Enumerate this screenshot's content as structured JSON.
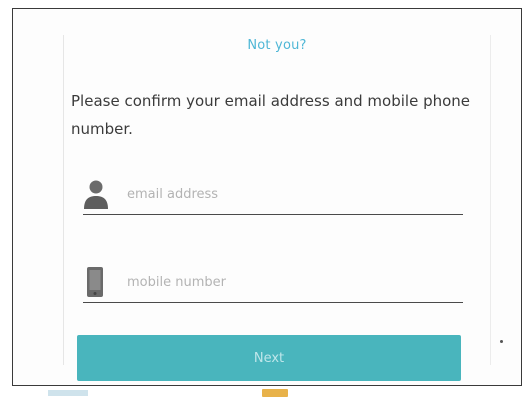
{
  "card": {
    "not_you_link": "Not you?",
    "instructions": "Please confirm your email address and mobile phone number.",
    "email_field": {
      "placeholder": "email address",
      "value": "",
      "icon": "person-icon"
    },
    "mobile_field": {
      "placeholder": "mobile number",
      "value": "",
      "icon": "phone-icon"
    },
    "next_button": "Next"
  },
  "colors": {
    "link": "#4fb7d6",
    "button_bg": "#49b5bd",
    "button_text": "#bfe6ea",
    "text": "#3b3b3b",
    "underline": "#4a4a4a"
  }
}
